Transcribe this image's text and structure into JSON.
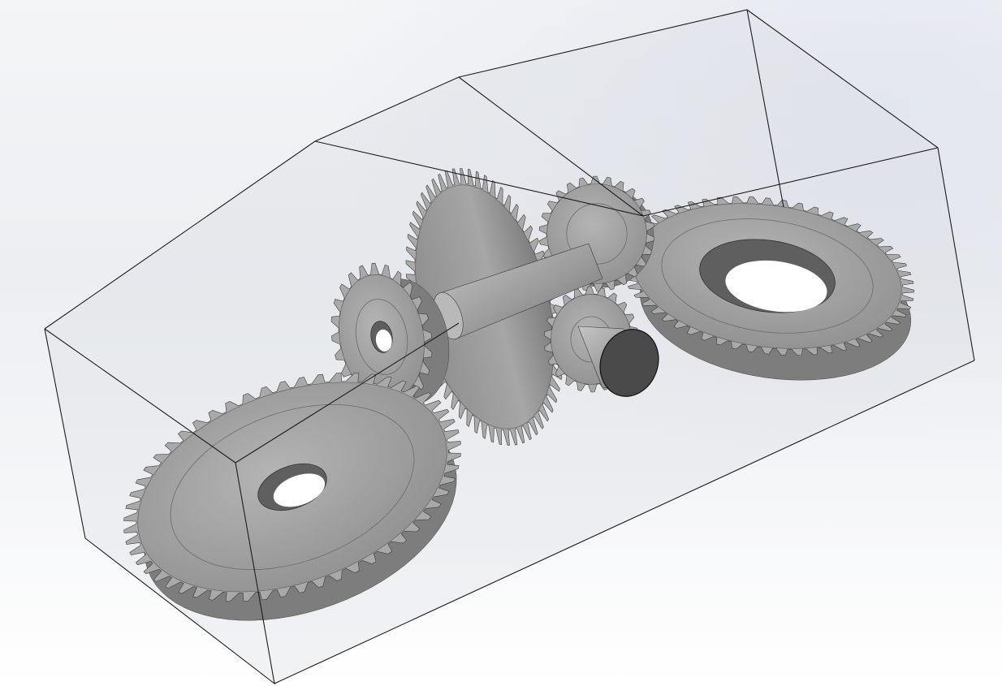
{
  "scene": {
    "model": "bevel-gear-assembly",
    "display_style": "shaded-with-edges",
    "housing_display": "transparent",
    "components": [
      {
        "name": "bevel-gear-large-left",
        "teeth": 56
      },
      {
        "name": "bevel-pinion-left",
        "teeth": 24
      },
      {
        "name": "spur-gear-center",
        "teeth": 60
      },
      {
        "name": "helical-pinion",
        "teeth": 26
      },
      {
        "name": "spur-pinion",
        "teeth": 22
      },
      {
        "name": "bevel-gear-large-right",
        "teeth": 56
      },
      {
        "name": "output-shaft"
      },
      {
        "name": "intermediate-shaft"
      }
    ],
    "colors": {
      "background_top": "#f4f5f7",
      "background_bottom": "#ffffff",
      "part_fill": "#9c9c9c",
      "part_dark": "#5a5a5a",
      "part_light": "#c8c8c8",
      "edge": "#1c1c1c",
      "housing_tint": "#c9ccd2"
    }
  }
}
